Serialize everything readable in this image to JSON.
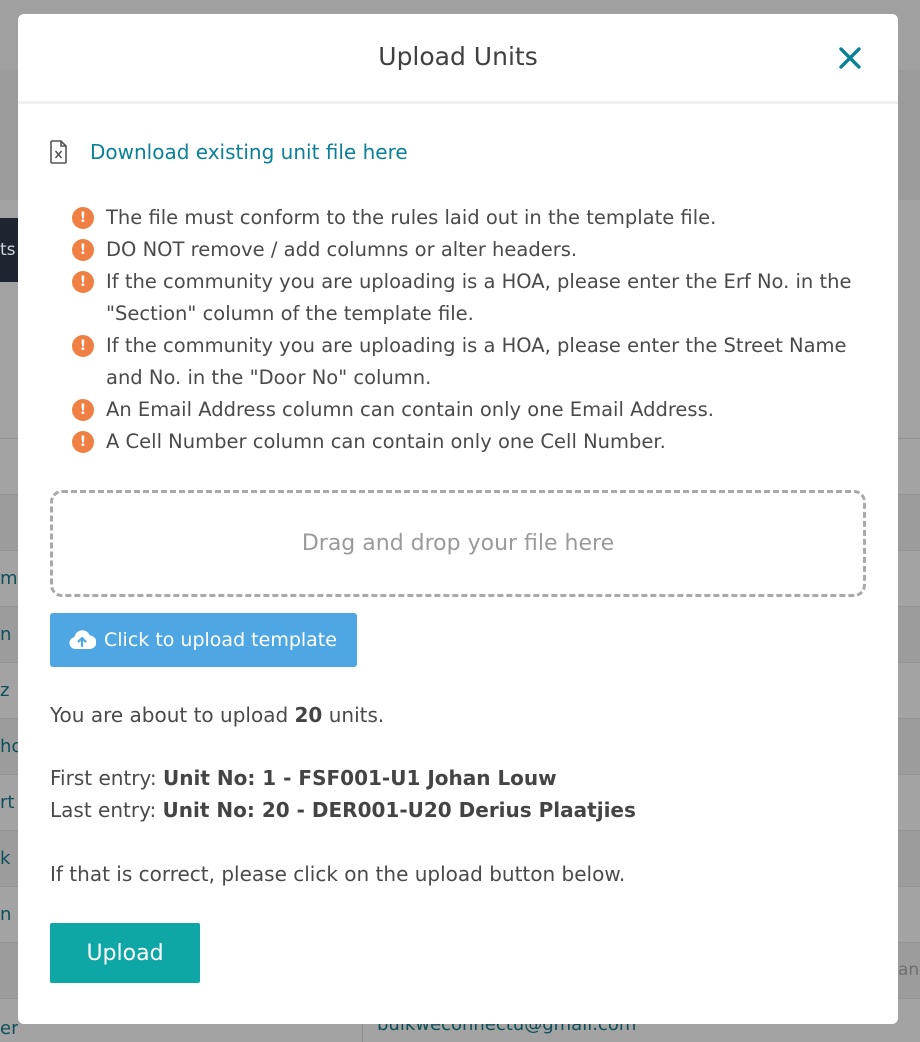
{
  "background": {
    "tab_fragment": "ts",
    "row_fragments": [
      "mp",
      "n S",
      "z",
      "ho",
      "rt",
      "k",
      "n"
    ],
    "footer_left": "er",
    "footer_email": "bulkweconnectu@gmail.com",
    "footer_right": "anc"
  },
  "modal": {
    "title": "Upload Units",
    "download_link": "Download existing unit file here",
    "rules": [
      "The file must conform to the rules laid out in the template file.",
      "DO NOT remove / add columns or alter headers.",
      "If the community you are uploading is a HOA, please enter the Erf No. in the \"Section\" column of the template file.",
      "If the community you are uploading is a HOA, please enter the Street Name and No. in the \"Door No\" column.",
      "An Email Address column can contain only one Email Address.",
      "A Cell Number column can contain only one Cell Number."
    ],
    "dropzone_text": "Drag and drop your file here",
    "upload_template_label": "Click to upload template",
    "summary_prefix": "You are about to upload",
    "summary_count": "20",
    "summary_suffix": "units.",
    "first_entry_label": "First entry:",
    "first_entry_value": "Unit No: 1 - FSF001-U1 Johan Louw",
    "last_entry_label": "Last entry:",
    "last_entry_value": "Unit No: 20 - DER001-U20 Derius Plaatjies",
    "confirm_text": "If that is correct, please click on the upload button below.",
    "upload_button": "Upload"
  },
  "icons": {
    "close": "close-icon",
    "file": "excel-file-icon",
    "warning": "warning-icon",
    "cloud": "cloud-upload-icon"
  },
  "colors": {
    "link": "#0a8199",
    "warning": "#f07f43",
    "template_button": "#4ea7e3",
    "upload_button": "#0fa6a6"
  }
}
